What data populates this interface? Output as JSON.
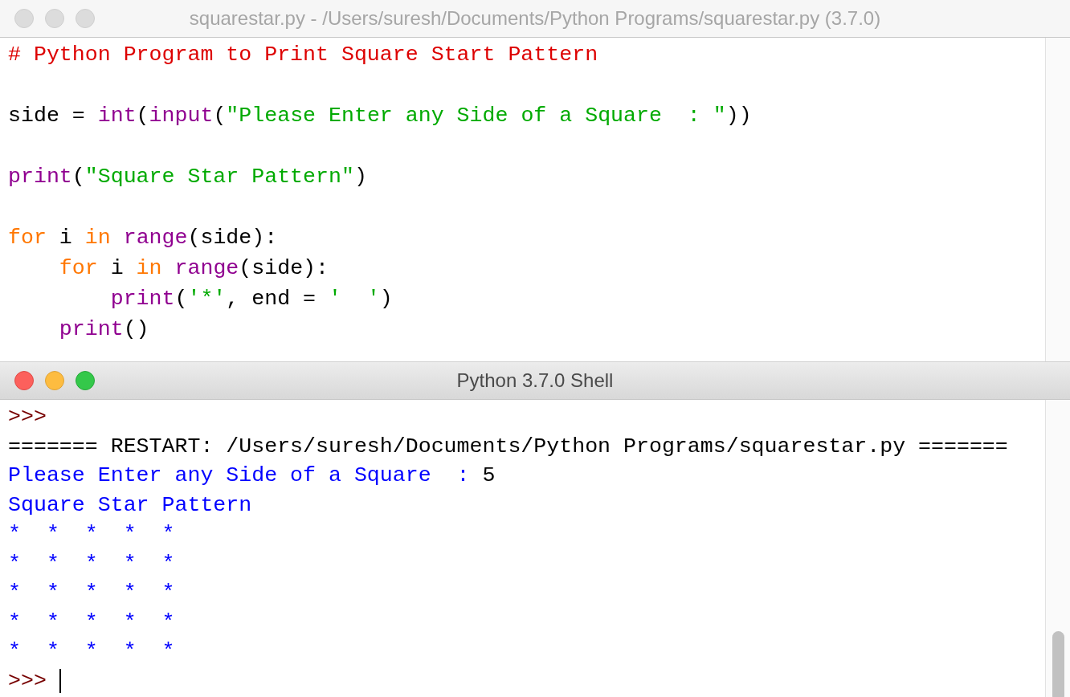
{
  "editor": {
    "title": "squarestar.py - /Users/suresh/Documents/Python Programs/squarestar.py (3.7.0)",
    "active": false,
    "lines": [
      {
        "kind": "code",
        "tokens": [
          {
            "text": "# Python Program to Print Square Start Pattern",
            "kind": "comment"
          }
        ]
      },
      {
        "kind": "blank"
      },
      {
        "kind": "code",
        "tokens": [
          {
            "text": "side = ",
            "kind": "plain"
          },
          {
            "text": "int",
            "kind": "builtin"
          },
          {
            "text": "(",
            "kind": "plain"
          },
          {
            "text": "input",
            "kind": "builtin"
          },
          {
            "text": "(",
            "kind": "plain"
          },
          {
            "text": "\"Please Enter any Side of a Square  : \"",
            "kind": "string"
          },
          {
            "text": "))",
            "kind": "plain"
          }
        ]
      },
      {
        "kind": "blank"
      },
      {
        "kind": "code",
        "tokens": [
          {
            "text": "print",
            "kind": "builtin"
          },
          {
            "text": "(",
            "kind": "plain"
          },
          {
            "text": "\"Square Star Pattern\"",
            "kind": "string"
          },
          {
            "text": ")",
            "kind": "plain"
          }
        ]
      },
      {
        "kind": "blank"
      },
      {
        "kind": "code",
        "tokens": [
          {
            "text": "for",
            "kind": "keyword"
          },
          {
            "text": " i ",
            "kind": "plain"
          },
          {
            "text": "in ",
            "kind": "keyword"
          },
          {
            "text": "range",
            "kind": "builtin"
          },
          {
            "text": "(side):",
            "kind": "plain"
          }
        ]
      },
      {
        "kind": "code",
        "tokens": [
          {
            "text": "    for",
            "kind": "keyword"
          },
          {
            "text": " i ",
            "kind": "plain"
          },
          {
            "text": "in ",
            "kind": "keyword"
          },
          {
            "text": "range",
            "kind": "builtin"
          },
          {
            "text": "(side):",
            "kind": "plain"
          }
        ]
      },
      {
        "kind": "code",
        "tokens": [
          {
            "text": "        print",
            "kind": "builtin"
          },
          {
            "text": "(",
            "kind": "plain"
          },
          {
            "text": "'*'",
            "kind": "string"
          },
          {
            "text": ", end = ",
            "kind": "plain"
          },
          {
            "text": "'  '",
            "kind": "string"
          },
          {
            "text": ")",
            "kind": "plain"
          }
        ]
      },
      {
        "kind": "code",
        "tokens": [
          {
            "text": "    print",
            "kind": "builtin"
          },
          {
            "text": "()",
            "kind": "plain"
          }
        ]
      }
    ]
  },
  "shell": {
    "title": "Python 3.7.0 Shell",
    "active": true,
    "lines": [
      {
        "kind": "code",
        "tokens": [
          {
            "text": ">>>",
            "kind": "prompt"
          }
        ]
      },
      {
        "kind": "code",
        "tokens": [
          {
            "text": "======= RESTART: /Users/suresh/Documents/Python Programs/squarestar.py =======",
            "kind": "plain"
          }
        ]
      },
      {
        "kind": "code",
        "tokens": [
          {
            "text": "Please Enter any Side of a Square  : ",
            "kind": "output"
          },
          {
            "text": "5",
            "kind": "plain"
          }
        ]
      },
      {
        "kind": "code",
        "tokens": [
          {
            "text": "Square Star Pattern",
            "kind": "output"
          }
        ]
      },
      {
        "kind": "code",
        "tokens": [
          {
            "text": "*  *  *  *  *",
            "kind": "output"
          }
        ]
      },
      {
        "kind": "code",
        "tokens": [
          {
            "text": "*  *  *  *  *",
            "kind": "output"
          }
        ]
      },
      {
        "kind": "code",
        "tokens": [
          {
            "text": "*  *  *  *  *",
            "kind": "output"
          }
        ]
      },
      {
        "kind": "code",
        "tokens": [
          {
            "text": "*  *  *  *  *",
            "kind": "output"
          }
        ]
      },
      {
        "kind": "code",
        "tokens": [
          {
            "text": "*  *  *  *  *",
            "kind": "output"
          }
        ]
      },
      {
        "kind": "code",
        "cursor": true,
        "tokens": [
          {
            "text": ">>> ",
            "kind": "prompt"
          }
        ]
      }
    ]
  }
}
